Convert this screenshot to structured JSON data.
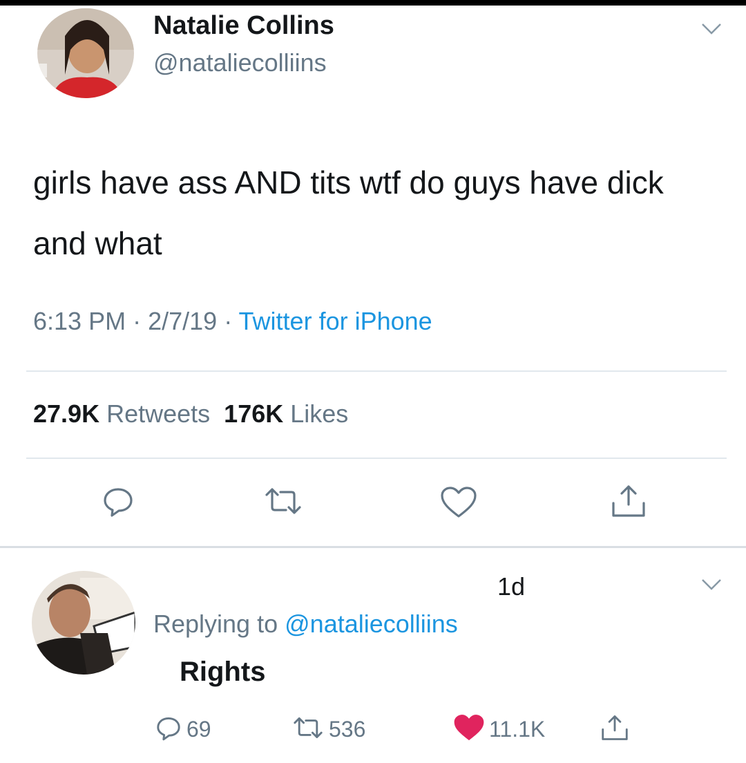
{
  "colors": {
    "link_blue": "#1b95e0",
    "secondary_gray": "#657786",
    "text_dark": "#14171a",
    "like_red": "#e0245e",
    "divider": "#e1e8ed"
  },
  "tweet": {
    "author": {
      "display_name": "Natalie Collins",
      "handle": "@nataliecolliins"
    },
    "text": "girls have ass AND tits wtf do guys have dick and what",
    "time": "6:13 PM",
    "date": "2/7/19",
    "source": "Twitter for iPhone",
    "stats": {
      "retweets_count": "27.9K",
      "retweets_label": "Retweets",
      "likes_count": "176K",
      "likes_label": "Likes"
    },
    "actions": {
      "reply_icon": "reply-icon",
      "retweet_icon": "retweet-icon",
      "like_icon": "heart-icon",
      "share_icon": "share-icon"
    }
  },
  "reply": {
    "time_ago": "1d",
    "replying_prefix": "Replying to",
    "replying_to": "@nataliecolliins",
    "text": "Rights",
    "reply_count": "69",
    "retweet_count": "536",
    "like_count": "11.1K",
    "liked": true
  }
}
